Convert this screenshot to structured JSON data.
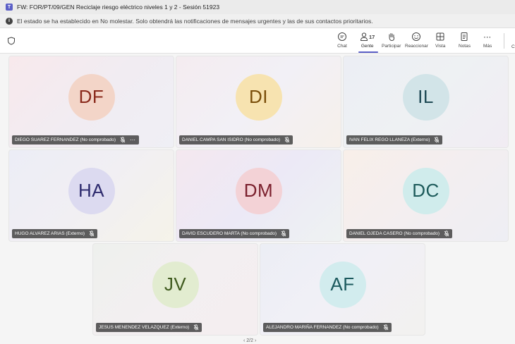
{
  "window": {
    "title": "FW: FOR/PT/09/GEN Reciclaje riesgo eléctrico niveles 1 y 2 - Sesión 51923"
  },
  "notice": {
    "text": "El estado se ha establecido en No molestar. Solo obtendrá las notificaciones de mensajes urgentes y las de sus contactos prioritarios."
  },
  "toolbar": {
    "chat": "Chat",
    "people": "Gente",
    "people_count": "17",
    "raise": "Participar",
    "react": "Reaccionar",
    "view": "Vista",
    "notes": "Notas",
    "more": "Más",
    "edge": "Ca"
  },
  "participants": [
    {
      "initials": "DF",
      "name": "DIEGO SUAREZ FERNANDEZ (No comprobado)",
      "color": "#8a2a1c",
      "bg": "#f3d5c8",
      "more": "⋯"
    },
    {
      "initials": "DI",
      "name": "DANIEL CAMPA SAN ISIDRO (No comprobado)",
      "color": "#7a4e0a",
      "bg": "#f7e3b0",
      "more": ""
    },
    {
      "initials": "IL",
      "name": "IVAN FELIX REGO LLANEZA (Externo)",
      "color": "#1f4a55",
      "bg": "#d2e4e8",
      "more": ""
    },
    {
      "initials": "HA",
      "name": "HUGO ALVAREZ ARIAS (Externo)",
      "color": "#2e2b6e",
      "bg": "#dcdaf0",
      "more": ""
    },
    {
      "initials": "DM",
      "name": "DAVID ESCUDERO MARTA (No comprobado)",
      "color": "#7a1f2c",
      "bg": "#f3d2d6",
      "more": ""
    },
    {
      "initials": "DC",
      "name": "DANIEL OJEDA CASERO (No comprobado)",
      "color": "#1c5a5a",
      "bg": "#d0ecec",
      "more": ""
    },
    {
      "initials": "JV",
      "name": "JESUS MENENDEZ VELAZQUEZ (Externo)",
      "color": "#3f5a1e",
      "bg": "#e2ecd0",
      "more": ""
    },
    {
      "initials": "AF",
      "name": "ALEJANDRO MARIÑA FERNANDEZ (No comprobado)",
      "color": "#1c5a5e",
      "bg": "#d2ecee",
      "more": ""
    }
  ],
  "pager": {
    "text": "2/2"
  }
}
